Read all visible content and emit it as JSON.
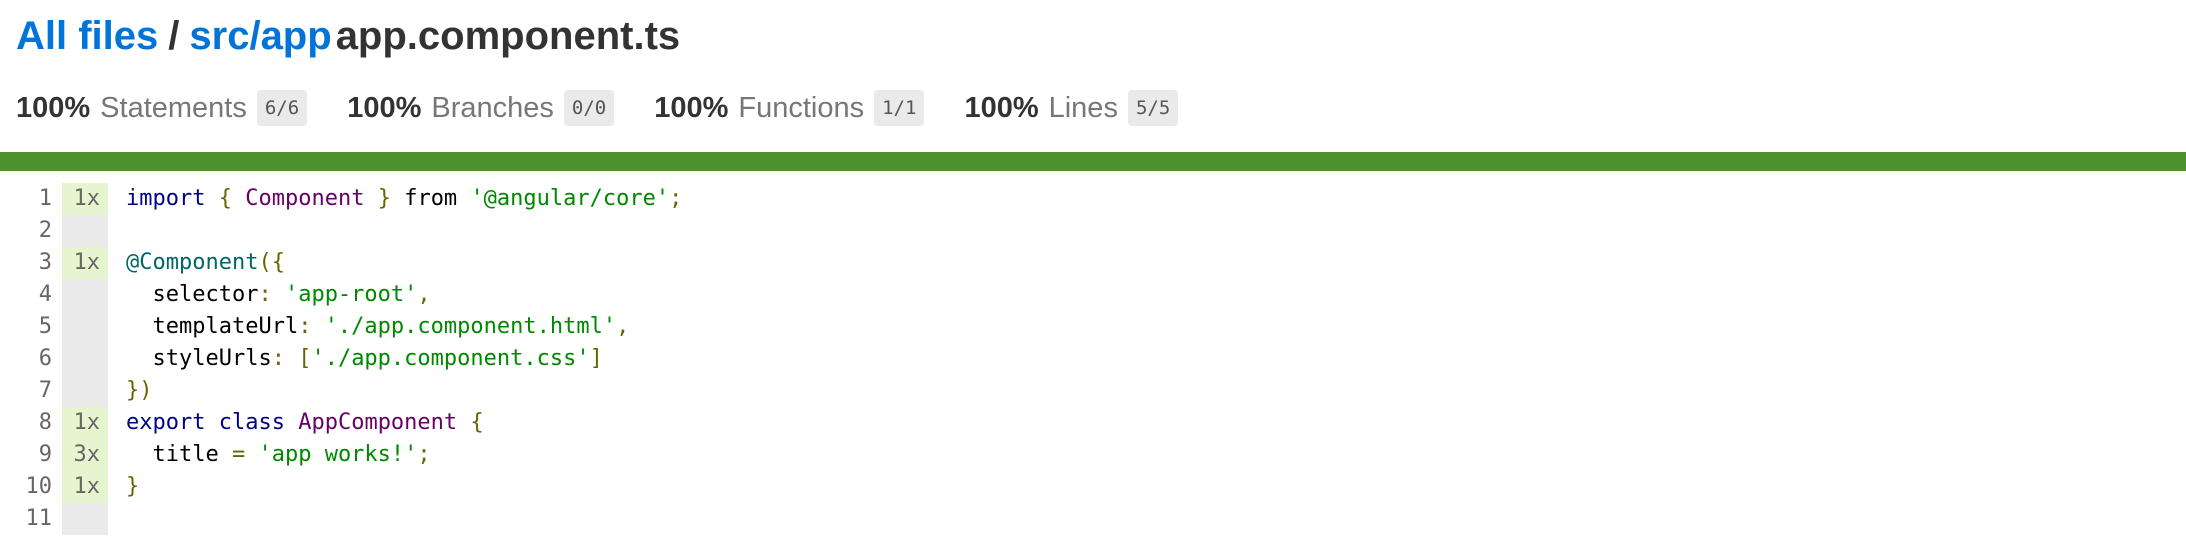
{
  "breadcrumb": {
    "root_label": "All files",
    "separator": "/",
    "dir_label": "src/app",
    "file_label": "app.component.ts"
  },
  "summary": [
    {
      "percent": "100%",
      "label": "Statements",
      "fraction": "6/6"
    },
    {
      "percent": "100%",
      "label": "Branches",
      "fraction": "0/0"
    },
    {
      "percent": "100%",
      "label": "Functions",
      "fraction": "1/1"
    },
    {
      "percent": "100%",
      "label": "Lines",
      "fraction": "5/5"
    }
  ],
  "status_color": "#4d922f",
  "coverage_hit_color": "#e6f5d0",
  "lines": [
    {
      "number": "1",
      "count": "1x",
      "tokens": [
        {
          "t": "import",
          "c": "kw"
        },
        {
          "t": " ",
          "c": "pln"
        },
        {
          "t": "{",
          "c": "pun"
        },
        {
          "t": " ",
          "c": "pln"
        },
        {
          "t": "Component",
          "c": "typ"
        },
        {
          "t": " ",
          "c": "pln"
        },
        {
          "t": "}",
          "c": "pun"
        },
        {
          "t": " from ",
          "c": "pln"
        },
        {
          "t": "'@angular/core'",
          "c": "str"
        },
        {
          "t": ";",
          "c": "pun"
        }
      ]
    },
    {
      "number": "2",
      "count": "",
      "tokens": []
    },
    {
      "number": "3",
      "count": "1x",
      "tokens": [
        {
          "t": "@Component",
          "c": "dec"
        },
        {
          "t": "({",
          "c": "pun"
        }
      ]
    },
    {
      "number": "4",
      "count": "",
      "tokens": [
        {
          "t": "  selector",
          "c": "pln"
        },
        {
          "t": ": ",
          "c": "pun"
        },
        {
          "t": "'app-root'",
          "c": "str"
        },
        {
          "t": ",",
          "c": "pun"
        }
      ]
    },
    {
      "number": "5",
      "count": "",
      "tokens": [
        {
          "t": "  templateUrl",
          "c": "pln"
        },
        {
          "t": ": ",
          "c": "pun"
        },
        {
          "t": "'./app.component.html'",
          "c": "str"
        },
        {
          "t": ",",
          "c": "pun"
        }
      ]
    },
    {
      "number": "6",
      "count": "",
      "tokens": [
        {
          "t": "  styleUrls",
          "c": "pln"
        },
        {
          "t": ": [",
          "c": "pun"
        },
        {
          "t": "'./app.component.css'",
          "c": "str"
        },
        {
          "t": "]",
          "c": "pun"
        }
      ]
    },
    {
      "number": "7",
      "count": "",
      "tokens": [
        {
          "t": "})",
          "c": "pun"
        }
      ]
    },
    {
      "number": "8",
      "count": "1x",
      "tokens": [
        {
          "t": "export",
          "c": "kw"
        },
        {
          "t": " ",
          "c": "pln"
        },
        {
          "t": "class",
          "c": "kw"
        },
        {
          "t": " ",
          "c": "pln"
        },
        {
          "t": "AppComponent",
          "c": "typ"
        },
        {
          "t": " ",
          "c": "pln"
        },
        {
          "t": "{",
          "c": "pun"
        }
      ]
    },
    {
      "number": "9",
      "count": "3x",
      "tokens": [
        {
          "t": "  title ",
          "c": "pln"
        },
        {
          "t": "=",
          "c": "pun"
        },
        {
          "t": " ",
          "c": "pln"
        },
        {
          "t": "'app works!'",
          "c": "str"
        },
        {
          "t": ";",
          "c": "pun"
        }
      ]
    },
    {
      "number": "10",
      "count": "1x",
      "tokens": [
        {
          "t": "}",
          "c": "pun"
        }
      ]
    },
    {
      "number": "11",
      "count": "",
      "tokens": []
    }
  ]
}
